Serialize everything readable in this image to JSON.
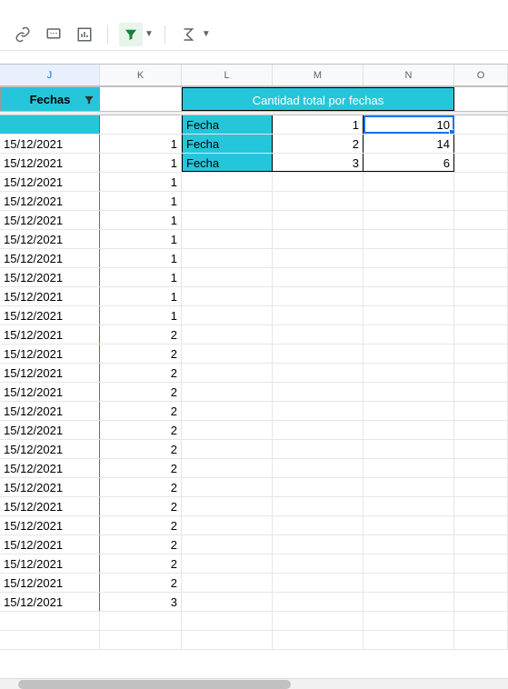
{
  "columns": [
    "J",
    "K",
    "L",
    "M",
    "N",
    "O"
  ],
  "headerJ": "Fechas",
  "mergedHeader": "Cantidad total por fechas",
  "summaryRows": [
    {
      "label": "Fecha",
      "m": "1",
      "n": "10"
    },
    {
      "label": "Fecha",
      "m": "2",
      "n": "14"
    },
    {
      "label": "Fecha",
      "m": "3",
      "n": "6"
    }
  ],
  "dataRows": [
    {
      "j": "",
      "k": ""
    },
    {
      "j": "15/12/2021",
      "k": "1"
    },
    {
      "j": "15/12/2021",
      "k": "1"
    },
    {
      "j": "15/12/2021",
      "k": "1"
    },
    {
      "j": "15/12/2021",
      "k": "1"
    },
    {
      "j": "15/12/2021",
      "k": "1"
    },
    {
      "j": "15/12/2021",
      "k": "1"
    },
    {
      "j": "15/12/2021",
      "k": "1"
    },
    {
      "j": "15/12/2021",
      "k": "1"
    },
    {
      "j": "15/12/2021",
      "k": "1"
    },
    {
      "j": "15/12/2021",
      "k": "1"
    },
    {
      "j": "15/12/2021",
      "k": "2"
    },
    {
      "j": "15/12/2021",
      "k": "2"
    },
    {
      "j": "15/12/2021",
      "k": "2"
    },
    {
      "j": "15/12/2021",
      "k": "2"
    },
    {
      "j": "15/12/2021",
      "k": "2"
    },
    {
      "j": "15/12/2021",
      "k": "2"
    },
    {
      "j": "15/12/2021",
      "k": "2"
    },
    {
      "j": "15/12/2021",
      "k": "2"
    },
    {
      "j": "15/12/2021",
      "k": "2"
    },
    {
      "j": "15/12/2021",
      "k": "2"
    },
    {
      "j": "15/12/2021",
      "k": "2"
    },
    {
      "j": "15/12/2021",
      "k": "2"
    },
    {
      "j": "15/12/2021",
      "k": "2"
    },
    {
      "j": "15/12/2021",
      "k": "2"
    },
    {
      "j": "15/12/2021",
      "k": "3"
    }
  ]
}
